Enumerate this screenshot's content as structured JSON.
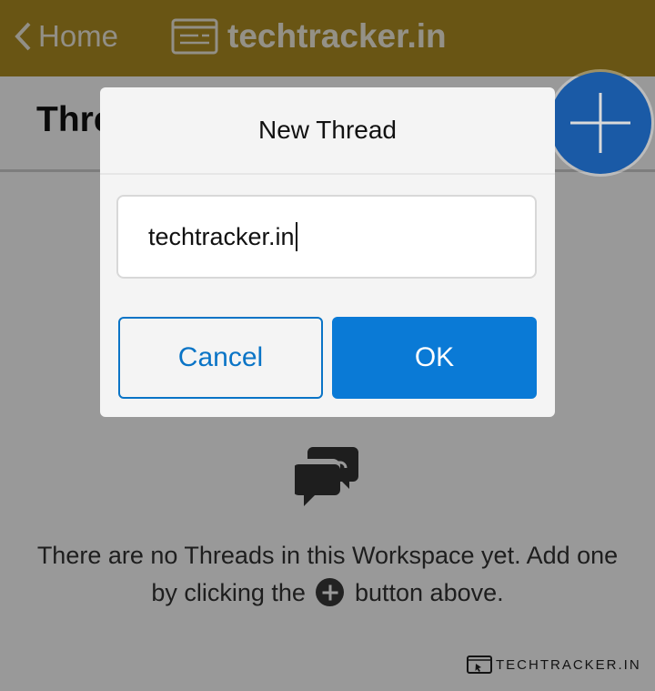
{
  "topbar": {
    "back_label": "Home",
    "brand": "techtracker.in",
    "color": "#b08e22"
  },
  "page": {
    "title": "Threads"
  },
  "empty_state": {
    "line1": "There are no Threads in this Workspace yet. Add one",
    "line2_before": "by clicking the",
    "line2_after": "button above."
  },
  "watermark": {
    "text": "TECHTRACKER.IN"
  },
  "dialog": {
    "title": "New Thread",
    "input_value": "techtracker.in",
    "cancel_label": "Cancel",
    "ok_label": "OK",
    "accent": "#0a7ad6"
  },
  "icons": {
    "back": "chevron-left-icon",
    "brand": "browser-window-icon",
    "search": "search-icon",
    "empty": "chat-bubbles-icon",
    "add": "plus-icon"
  }
}
